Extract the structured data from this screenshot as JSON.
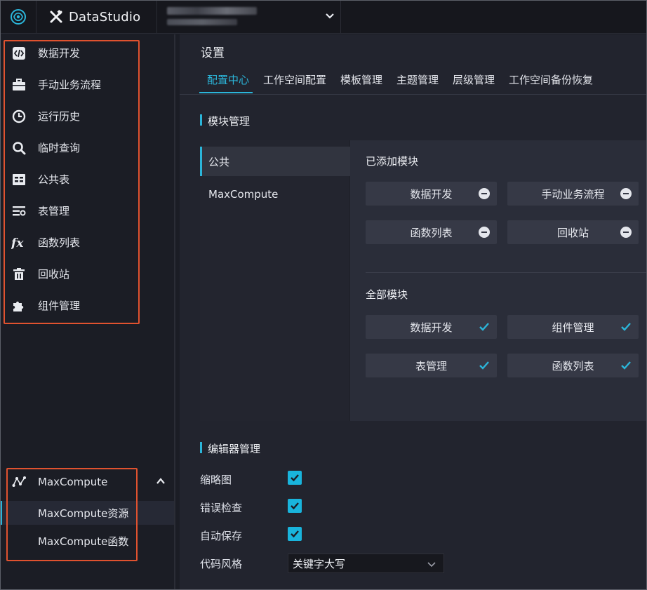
{
  "topbar": {
    "brand": "DataStudio",
    "workspace_placeholder": ""
  },
  "sidebar": {
    "items": [
      {
        "label": "数据开发",
        "icon": "code-icon"
      },
      {
        "label": "手动业务流程",
        "icon": "briefcase-icon"
      },
      {
        "label": "运行历史",
        "icon": "clock-icon"
      },
      {
        "label": "临时查询",
        "icon": "search-icon"
      },
      {
        "label": "公共表",
        "icon": "table-icon"
      },
      {
        "label": "表管理",
        "icon": "list-icon"
      },
      {
        "label": "函数列表",
        "icon": "fx-icon"
      },
      {
        "label": "回收站",
        "icon": "trash-icon"
      },
      {
        "label": "组件管理",
        "icon": "puzzle-icon"
      }
    ],
    "maxcompute": {
      "label": "MaxCompute",
      "children": [
        "MaxCompute资源",
        "MaxCompute函数"
      ]
    }
  },
  "main": {
    "title": "设置",
    "tabs": [
      "配置中心",
      "工作空间配置",
      "模板管理",
      "主题管理",
      "层级管理",
      "工作空间备份恢复"
    ],
    "module_section": {
      "title": "模块管理",
      "list": [
        "公共",
        "MaxCompute"
      ],
      "added_title": "已添加模块",
      "added": [
        "数据开发",
        "手动业务流程",
        "函数列表",
        "回收站"
      ],
      "all_title": "全部模块",
      "all": [
        "数据开发",
        "组件管理",
        "表管理",
        "函数列表"
      ]
    },
    "editor_section": {
      "title": "编辑器管理",
      "options": [
        {
          "label": "缩略图",
          "checked": true
        },
        {
          "label": "错误检查",
          "checked": true
        },
        {
          "label": "自动保存",
          "checked": true
        }
      ],
      "code_style_label": "代码风格",
      "code_style_value": "关键字大写"
    }
  },
  "colors": {
    "accent": "#2bb5d9",
    "highlight_box": "#e0522f"
  }
}
